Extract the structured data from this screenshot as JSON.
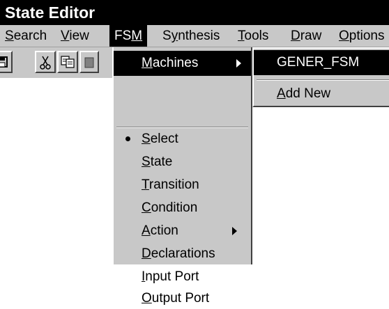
{
  "window": {
    "title": "State Editor"
  },
  "menubar": {
    "items": [
      {
        "pre": "",
        "ul": "S",
        "post": "earch"
      },
      {
        "pre": "",
        "ul": "V",
        "post": "iew"
      },
      {
        "pre": "FS",
        "ul": "M",
        "post": ""
      },
      {
        "pre": "S",
        "ul": "y",
        "post": "nthesis"
      },
      {
        "pre": "",
        "ul": "T",
        "post": "ools"
      },
      {
        "pre": "",
        "ul": "D",
        "post": "raw"
      },
      {
        "pre": "",
        "ul": "O",
        "post": "ptions"
      }
    ]
  },
  "toolbar": {
    "buttons": [
      {
        "icon": "save-icon"
      },
      {
        "icon": "cut-icon"
      },
      {
        "icon": "copy-icon"
      },
      {
        "icon": "paste-icon"
      }
    ]
  },
  "fsm_menu": {
    "machines": {
      "pre": "",
      "ul": "M",
      "post": "achines"
    },
    "items": [
      {
        "pre": "",
        "ul": "S",
        "post": "elect",
        "checked": true
      },
      {
        "pre": "",
        "ul": "S",
        "post": "tate"
      },
      {
        "pre": "",
        "ul": "T",
        "post": "ransition"
      },
      {
        "pre": "",
        "ul": "C",
        "post": "ondition"
      },
      {
        "pre": "",
        "ul": "A",
        "post": "ction",
        "submenu": true
      },
      {
        "pre": "",
        "ul": "D",
        "post": "eclarations"
      },
      {
        "pre": "",
        "ul": "I",
        "post": "nput Port"
      },
      {
        "pre": "",
        "ul": "O",
        "post": "utput Port"
      }
    ]
  },
  "machines_submenu": {
    "current": "GENER_FSM",
    "add_new": {
      "pre": "",
      "ul": "A",
      "post": "dd New"
    }
  },
  "colors": {
    "menu_bg": "#c8c8c8",
    "highlight": "#000000",
    "highlight_text": "#ffffff"
  }
}
